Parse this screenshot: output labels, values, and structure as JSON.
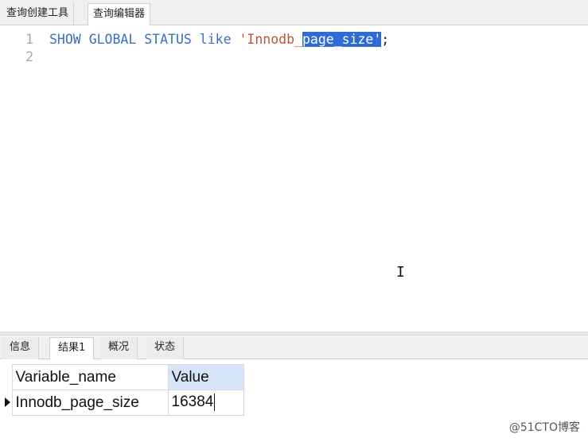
{
  "top_tabs": [
    {
      "label": "查询创建工具",
      "active": false
    },
    {
      "label": "查询编辑器",
      "active": true
    }
  ],
  "editor": {
    "lines": [
      {
        "number": "1",
        "kw1": "SHOW",
        "kw2": "GLOBAL",
        "kw3": "STATUS",
        "kw4": "like",
        "str_quote_open": "'",
        "str_plain": "Innodb_",
        "str_selected": "page_size'",
        "terminator": ";"
      },
      {
        "number": "2"
      }
    ],
    "cursor_glyph": "I"
  },
  "bottom_tabs": [
    {
      "label": "信息",
      "active": false
    },
    {
      "label": "结果1",
      "active": true
    },
    {
      "label": "概况",
      "active": false
    },
    {
      "label": "状态",
      "active": false
    }
  ],
  "results": {
    "columns": [
      "Variable_name",
      "Value"
    ],
    "rows": [
      [
        "Innodb_page_size",
        "16384"
      ]
    ]
  },
  "watermark": "@51CTO博客",
  "colors": {
    "keyword": "#3a6fc4",
    "string": "#b8543b",
    "selection": "#2f6bd6",
    "selected_column_header": "#d6e6f8"
  }
}
